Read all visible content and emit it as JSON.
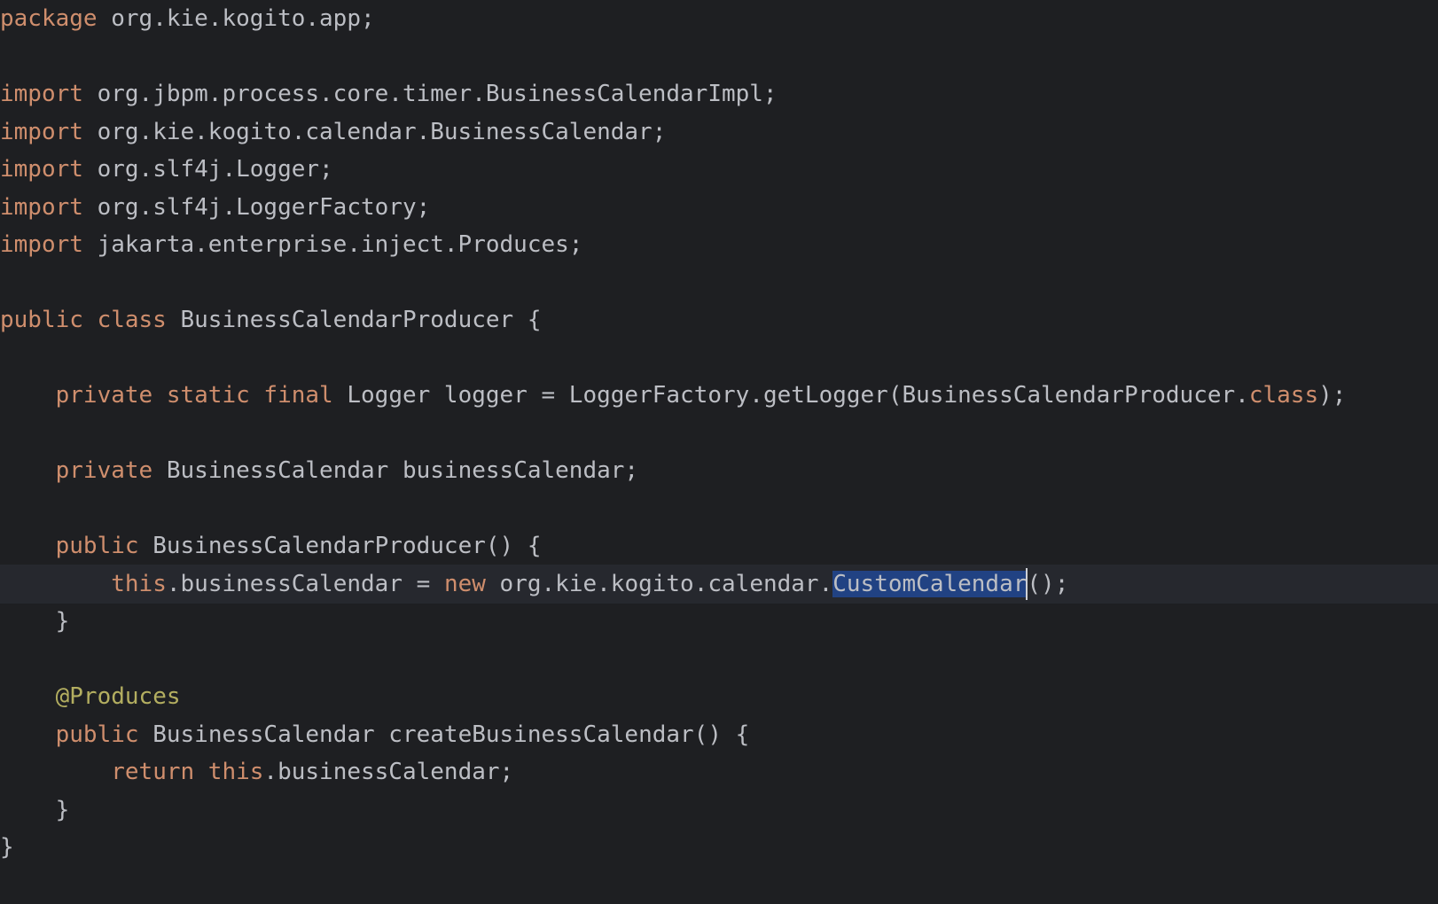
{
  "lines": [
    [
      {
        "t": "package",
        "c": "kw"
      },
      {
        "t": " org.kie.kogito.app;",
        "c": ""
      }
    ],
    [],
    [
      {
        "t": "import",
        "c": "kw"
      },
      {
        "t": " org.jbpm.process.core.timer.BusinessCalendarImpl;",
        "c": ""
      }
    ],
    [
      {
        "t": "import",
        "c": "kw"
      },
      {
        "t": " org.kie.kogito.calendar.BusinessCalendar;",
        "c": ""
      }
    ],
    [
      {
        "t": "import",
        "c": "kw"
      },
      {
        "t": " org.slf4j.Logger;",
        "c": ""
      }
    ],
    [
      {
        "t": "import",
        "c": "kw"
      },
      {
        "t": " org.slf4j.LoggerFactory;",
        "c": ""
      }
    ],
    [
      {
        "t": "import",
        "c": "kw"
      },
      {
        "t": " jakarta.enterprise.inject.Produces;",
        "c": ""
      }
    ],
    [],
    [
      {
        "t": "public class",
        "c": "kw"
      },
      {
        "t": " BusinessCalendarProducer {",
        "c": ""
      }
    ],
    [],
    [
      {
        "t": "    ",
        "c": ""
      },
      {
        "t": "private static final",
        "c": "kw"
      },
      {
        "t": " Logger logger = LoggerFactory.getLogger(BusinessCalendarProducer.",
        "c": ""
      },
      {
        "t": "class",
        "c": "kw"
      },
      {
        "t": ");",
        "c": ""
      }
    ],
    [],
    [
      {
        "t": "    ",
        "c": ""
      },
      {
        "t": "private",
        "c": "kw"
      },
      {
        "t": " BusinessCalendar businessCalendar;",
        "c": ""
      }
    ],
    [],
    [
      {
        "t": "    ",
        "c": ""
      },
      {
        "t": "public",
        "c": "kw"
      },
      {
        "t": " BusinessCalendarProducer() {",
        "c": ""
      }
    ],
    [
      {
        "t": "        ",
        "c": ""
      },
      {
        "t": "this",
        "c": "kw"
      },
      {
        "t": ".businessCalendar = ",
        "c": ""
      },
      {
        "t": "new",
        "c": "kw"
      },
      {
        "t": " org.kie.kogito.calendar.",
        "c": ""
      },
      {
        "t": "CustomCalendar",
        "c": "sel"
      },
      {
        "t": "",
        "c": "caret"
      },
      {
        "t": "();",
        "c": ""
      }
    ],
    [
      {
        "t": "    }",
        "c": ""
      }
    ],
    [],
    [
      {
        "t": "    ",
        "c": ""
      },
      {
        "t": "@Produces",
        "c": "ann"
      }
    ],
    [
      {
        "t": "    ",
        "c": ""
      },
      {
        "t": "public",
        "c": "kw"
      },
      {
        "t": " BusinessCalendar createBusinessCalendar() {",
        "c": ""
      }
    ],
    [
      {
        "t": "        ",
        "c": ""
      },
      {
        "t": "return this",
        "c": "kw"
      },
      {
        "t": ".businessCalendar;",
        "c": ""
      }
    ],
    [
      {
        "t": "    }",
        "c": ""
      }
    ],
    [
      {
        "t": "}",
        "c": ""
      }
    ]
  ],
  "current_line": 16,
  "colors": {
    "background": "#1e1f22",
    "current_line": "#26282e",
    "text": "#bcbec4",
    "keyword": "#cf8e6d",
    "annotation": "#b3ae60",
    "selection": "#214283",
    "caret": "#ced0d6"
  }
}
